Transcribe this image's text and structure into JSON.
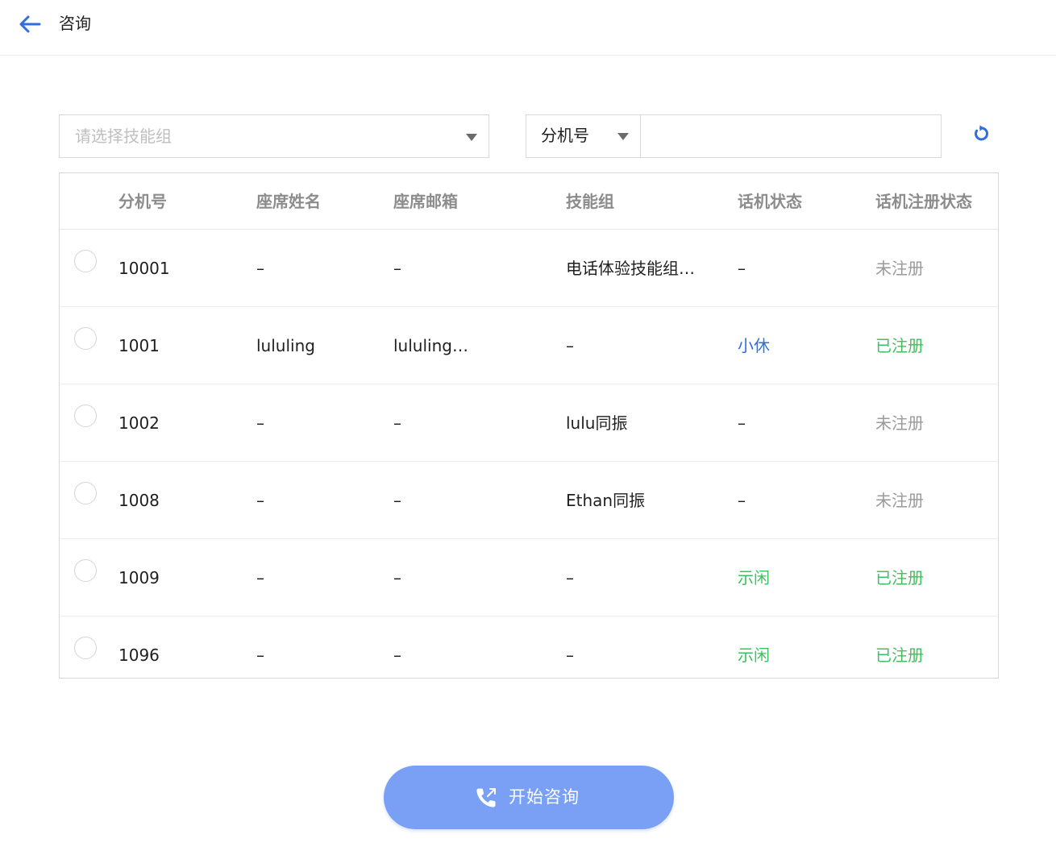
{
  "header": {
    "title": "咨询"
  },
  "filters": {
    "skill_placeholder": "请选择技能组",
    "search_field": "分机号",
    "search_value": ""
  },
  "colors": {
    "primary": "#2f6de1",
    "idle": "#3fbf5e",
    "registered": "#3fbf5e",
    "rest": "#2f6de1",
    "unregistered": "#9a9a9a",
    "button": "#7aa0f5"
  },
  "table": {
    "columns": [
      "分机号",
      "座席姓名",
      "座席邮箱",
      "技能组",
      "话机状态",
      "话机注册状态"
    ],
    "rows": [
      {
        "ext": "10001",
        "name": "–",
        "email": "–",
        "skill": "电话体验技能组…",
        "phone_status": "–",
        "phone_status_color": "#1f1f1f",
        "reg_status": "未注册",
        "reg_status_color": "#9a9a9a"
      },
      {
        "ext": "1001",
        "name": "lululing",
        "email": "lululing…",
        "skill": "–",
        "phone_status": "小休",
        "phone_status_color": "#2f6de1",
        "reg_status": "已注册",
        "reg_status_color": "#3fbf5e"
      },
      {
        "ext": "1002",
        "name": "–",
        "email": "–",
        "skill": "lulu同振",
        "phone_status": "–",
        "phone_status_color": "#1f1f1f",
        "reg_status": "未注册",
        "reg_status_color": "#9a9a9a"
      },
      {
        "ext": "1008",
        "name": "–",
        "email": "–",
        "skill": "Ethan同振",
        "phone_status": "–",
        "phone_status_color": "#1f1f1f",
        "reg_status": "未注册",
        "reg_status_color": "#9a9a9a"
      },
      {
        "ext": "1009",
        "name": "–",
        "email": "–",
        "skill": "–",
        "phone_status": "示闲",
        "phone_status_color": "#3fbf5e",
        "reg_status": "已注册",
        "reg_status_color": "#3fbf5e"
      },
      {
        "ext": "1096",
        "name": "–",
        "email": "–",
        "skill": "–",
        "phone_status": "示闲",
        "phone_status_color": "#3fbf5e",
        "reg_status": "已注册",
        "reg_status_color": "#3fbf5e"
      }
    ]
  },
  "actions": {
    "start_label": "开始咨询"
  },
  "icons": {
    "back": "arrow-left-icon",
    "dropdown": "caret-down-icon",
    "refresh": "refresh-icon",
    "call": "phone-transfer-icon"
  }
}
